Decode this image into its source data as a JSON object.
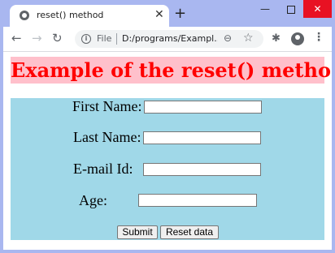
{
  "browser": {
    "tab_title": "reset() method",
    "new_tab": "+",
    "tab_close": "✕",
    "file_label": "File",
    "url": "D:/programs/Exampl..."
  },
  "page": {
    "heading": "Example of the reset() method",
    "heading_color": "#ff0000",
    "heading_bg": "#ffc0cb",
    "form_bg": "#a0d8e8"
  },
  "form": {
    "first_name_label": "First Name:",
    "first_name_value": "",
    "last_name_label": "Last Name:",
    "last_name_value": "",
    "email_label": "E-mail Id:",
    "email_value": "",
    "age_label": "Age:",
    "age_value": "",
    "submit_label": "Submit",
    "reset_label": "Reset data"
  }
}
